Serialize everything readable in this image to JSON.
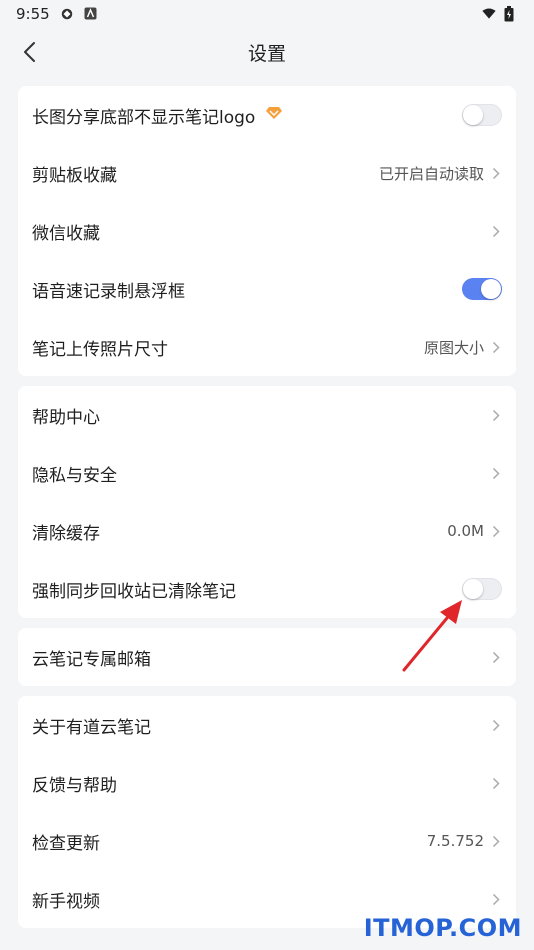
{
  "status_bar": {
    "time": "9:55"
  },
  "nav": {
    "title": "设置"
  },
  "groups": [
    {
      "rows": [
        {
          "label": "长图分享底部不显示笔记logo",
          "control": "toggle",
          "state": "off",
          "badge": "vip-diamond-icon"
        },
        {
          "label": "剪贴板收藏",
          "value": "已开启自动读取",
          "control": "chevron"
        },
        {
          "label": "微信收藏",
          "value": "",
          "control": "chevron"
        },
        {
          "label": "语音速记录制悬浮框",
          "control": "toggle",
          "state": "on"
        },
        {
          "label": "笔记上传照片尺寸",
          "value": "原图大小",
          "control": "chevron"
        }
      ]
    },
    {
      "rows": [
        {
          "label": "帮助中心",
          "value": "",
          "control": "chevron"
        },
        {
          "label": "隐私与安全",
          "value": "",
          "control": "chevron"
        },
        {
          "label": "清除缓存",
          "value": "0.0M",
          "control": "chevron"
        },
        {
          "label": "强制同步回收站已清除笔记",
          "control": "toggle",
          "state": "off"
        }
      ]
    },
    {
      "rows": [
        {
          "label": "云笔记专属邮箱",
          "value": "",
          "control": "chevron"
        }
      ]
    },
    {
      "rows": [
        {
          "label": "关于有道云笔记",
          "value": "",
          "control": "chevron"
        },
        {
          "label": "反馈与帮助",
          "value": "",
          "control": "chevron"
        },
        {
          "label": "检查更新",
          "value": "7.5.752",
          "control": "chevron"
        },
        {
          "label": "新手视频",
          "value": "",
          "control": "chevron"
        }
      ]
    }
  ],
  "colors": {
    "toggle_on": "#5a82f0",
    "annotation_arrow": "#e0262b",
    "watermark": "#2563d6",
    "vip_badge": "#f5a03c"
  },
  "watermark": "ITMOP.COM"
}
